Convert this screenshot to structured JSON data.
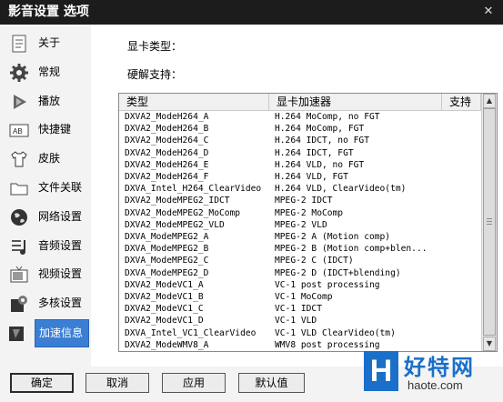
{
  "window": {
    "title": "影音设置 选项",
    "close_glyph": "✕"
  },
  "sidebar": {
    "items": [
      {
        "label": "关于",
        "icon": "doc-icon"
      },
      {
        "label": "常规",
        "icon": "gear-icon"
      },
      {
        "label": "播放",
        "icon": "play-icon"
      },
      {
        "label": "快捷键",
        "icon": "keyboard-icon"
      },
      {
        "label": "皮肤",
        "icon": "shirt-icon"
      },
      {
        "label": "文件关联",
        "icon": "folder-icon"
      },
      {
        "label": "网络设置",
        "icon": "globe-icon"
      },
      {
        "label": "音频设置",
        "icon": "audio-icon"
      },
      {
        "label": "视频设置",
        "icon": "tv-icon"
      },
      {
        "label": "多核设置",
        "icon": "cores-icon"
      },
      {
        "label": "加速信息",
        "icon": "accel-icon",
        "active": true
      }
    ]
  },
  "main": {
    "gpu_type_label": "显卡类型：",
    "hw_support_label": "硬解支持："
  },
  "table": {
    "columns": [
      "类型",
      "显卡加速器",
      "支持"
    ],
    "rows": [
      [
        "DXVA2_ModeH264_A",
        "H.264 MoComp, no FGT"
      ],
      [
        "DXVA2_ModeH264_B",
        "H.264 MoComp, FGT"
      ],
      [
        "DXVA2_ModeH264_C",
        "H.264 IDCT, no FGT"
      ],
      [
        "DXVA2_ModeH264_D",
        "H.264 IDCT, FGT"
      ],
      [
        "DXVA2_ModeH264_E",
        "H.264 VLD, no FGT"
      ],
      [
        "DXVA2_ModeH264_F",
        "H.264 VLD, FGT"
      ],
      [
        "DXVA_Intel_H264_ClearVideo",
        "H.264 VLD, ClearVideo(tm)"
      ],
      [
        "DXVA2_ModeMPEG2_IDCT",
        "MPEG-2 IDCT"
      ],
      [
        "DXVA2_ModeMPEG2_MoComp",
        "MPEG-2 MoComp"
      ],
      [
        "DXVA2_ModeMPEG2_VLD",
        "MPEG-2 VLD"
      ],
      [
        "DXVA_ModeMPEG2_A",
        "MPEG-2 A (Motion comp)"
      ],
      [
        "DXVA_ModeMPEG2_B",
        "MPEG-2 B (Motion comp+blen..."
      ],
      [
        "DXVA_ModeMPEG2_C",
        "MPEG-2 C (IDCT)"
      ],
      [
        "DXVA_ModeMPEG2_D",
        "MPEG-2 D (IDCT+blending)"
      ],
      [
        "DXVA2_ModeVC1_A",
        "VC-1 post processing"
      ],
      [
        "DXVA2_ModeVC1_B",
        "VC-1 MoComp"
      ],
      [
        "DXVA2_ModeVC1_C",
        "VC-1 IDCT"
      ],
      [
        "DXVA2_ModeVC1_D",
        "VC-1 VLD"
      ],
      [
        "DXVA_Intel_VC1_ClearVideo",
        "VC-1 VLD ClearVideo(tm)"
      ],
      [
        "DXVA2_ModeWMV8_A",
        "WMV8 post processing"
      ]
    ]
  },
  "footer": {
    "ok": "确定",
    "cancel": "取消",
    "apply": "应用",
    "default": "默认值"
  },
  "watermark": {
    "mark": "H",
    "cn": "好特网",
    "en": "haote.com"
  },
  "colors": {
    "titlebar": "#1c1c1c",
    "accent": "#3b7fd4",
    "logo": "#1a6fc9"
  }
}
